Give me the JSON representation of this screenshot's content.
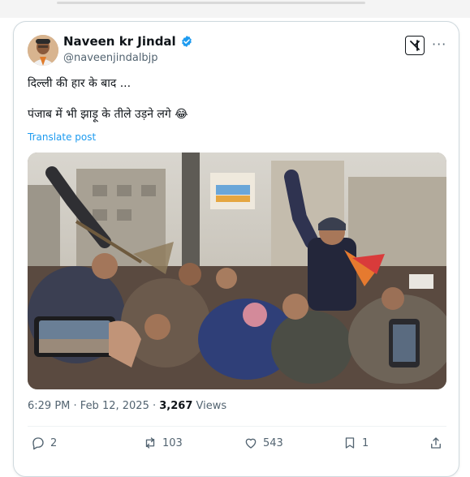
{
  "tweet": {
    "author_name": "Naveen kr Jindal",
    "author_handle": "@naveenjindalbjp",
    "text_line1": "दिल्ली की हार के बाद ...",
    "text_line2": "पंजाब में भी झाड़ू के तीले उड़ने लगे 😂",
    "translate_label": "Translate post",
    "time": "6:29 PM",
    "date": "Feb 12, 2025",
    "views_count": "3,267",
    "views_label": "Views"
  },
  "actions": {
    "replies": "2",
    "reposts": "103",
    "likes": "543",
    "bookmarks": "1"
  },
  "icons": {
    "verified": "verified-badge-icon",
    "grok": "grok-icon",
    "more": "more-icon",
    "reply": "reply-icon",
    "repost": "repost-icon",
    "like": "heart-icon",
    "bookmark": "bookmark-icon",
    "share": "share-icon"
  },
  "colors": {
    "link": "#1d9bf0",
    "verified": "#1d9bf0",
    "secondary_text": "#536471"
  }
}
